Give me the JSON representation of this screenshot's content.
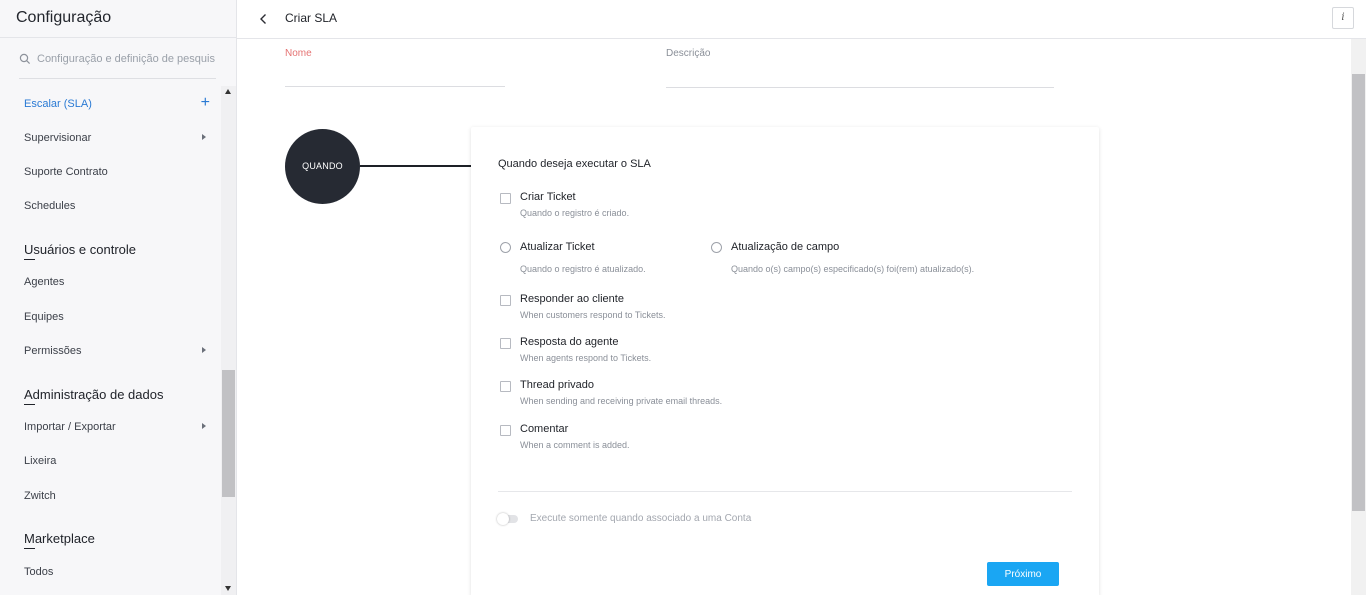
{
  "sidebar": {
    "title": "Configuração",
    "search_placeholder": "Configuração e definição de pesquisa",
    "items": [
      {
        "label": "Escalar (SLA)"
      },
      {
        "label": "Supervisionar"
      },
      {
        "label": "Suporte Contrato"
      },
      {
        "label": "Schedules"
      },
      {
        "label": "Agentes"
      },
      {
        "label": "Equipes"
      },
      {
        "label": "Permissões"
      },
      {
        "label": "Importar / Exportar"
      },
      {
        "label": "Lixeira"
      },
      {
        "label": "Zwitch"
      },
      {
        "label": "Todos"
      }
    ],
    "sections": [
      {
        "label": "Usuários e controle"
      },
      {
        "label": "Administração de dados"
      },
      {
        "label": "Marketplace"
      }
    ]
  },
  "header": {
    "title": "Criar SLA",
    "info_label": "i"
  },
  "form": {
    "name_label": "Nome",
    "name_value": "",
    "description_label": "Descrição",
    "description_value": ""
  },
  "flow": {
    "node_label": "QUANDO"
  },
  "card": {
    "heading": "Quando deseja executar o SLA",
    "options": [
      {
        "title": "Criar Ticket",
        "description": "Quando o registro é criado."
      },
      {
        "title": "Atualizar Ticket",
        "description": "Quando o registro é atualizado."
      },
      {
        "title": "Atualização de campo",
        "description": "Quando o(s) campo(s) especificado(s) foi(rem) atualizado(s)."
      },
      {
        "title": "Responder ao cliente",
        "description": "When customers respond to Tickets."
      },
      {
        "title": "Resposta do agente",
        "description": "When agents respond to Tickets."
      },
      {
        "title": "Thread privado",
        "description": "When sending and receiving private email threads."
      },
      {
        "title": "Comentar",
        "description": "When a comment is added."
      }
    ],
    "toggle_label": "Execute somente quando associado a uma Conta",
    "toggle_on": false,
    "next_label": "Próximo"
  },
  "colors": {
    "accent": "#1aa6f3",
    "active_link": "#2a7ad4",
    "required_label": "#e57373",
    "node_bg": "#262a33"
  }
}
